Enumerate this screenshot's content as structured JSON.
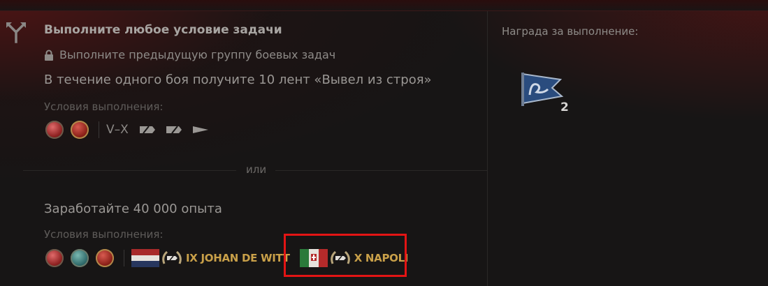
{
  "task": {
    "title": "Выполните любое условие задачи",
    "lock_text": "Выполните предыдущую группу боевых задач",
    "condition1": {
      "text": "В течение одного боя получите 10 лент «Вывел из строя»",
      "conditions_label": "Условия выполнения:",
      "tier_range": "V–X"
    },
    "separator": "или",
    "condition2": {
      "text": "Заработайте 40 000 опыта",
      "conditions_label": "Условия выполнения:",
      "tanks": [
        {
          "name": "IX JOHAN DE WITT",
          "flag": "netherlands"
        },
        {
          "name": "X NAPOLI",
          "flag": "italy"
        }
      ]
    }
  },
  "reward": {
    "label": "Награда за выполнение:",
    "count": "2",
    "icon": "pennant-flag-icon"
  },
  "colors": {
    "highlight": "#e21414",
    "tank_name": "#c9a049"
  }
}
